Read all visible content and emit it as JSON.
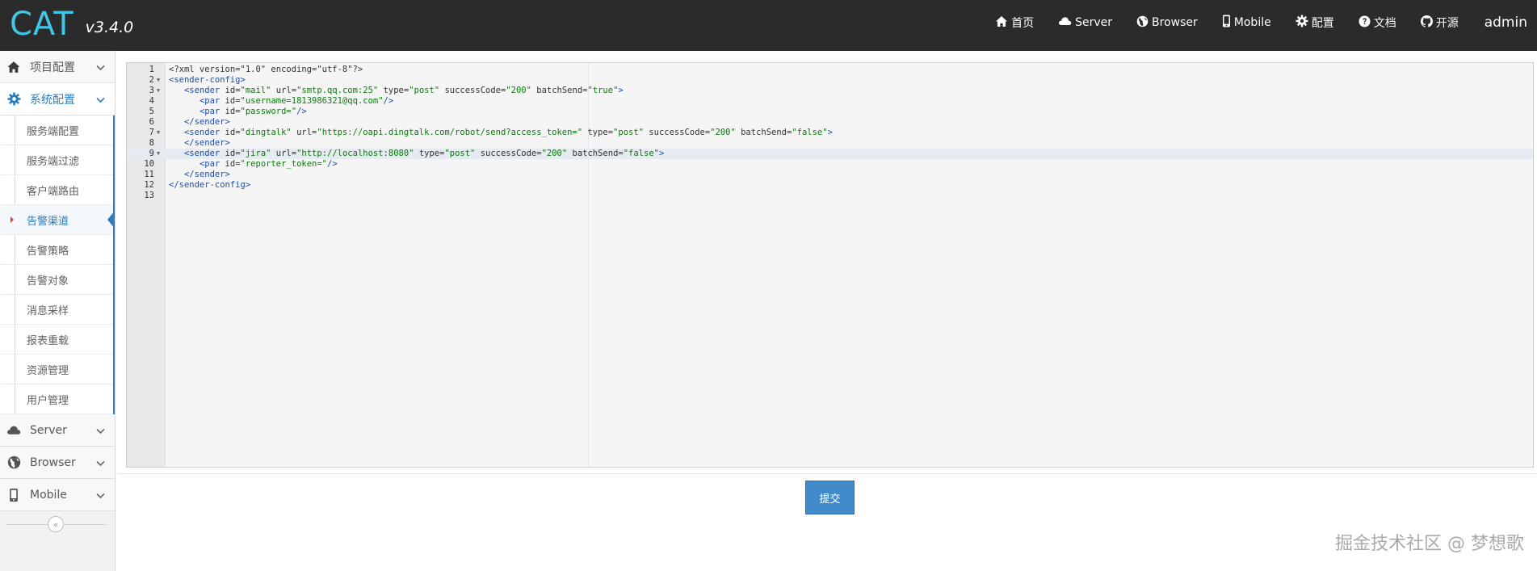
{
  "brand": {
    "logo": "CAT",
    "version": "v3.4.0"
  },
  "nav": [
    {
      "label": "首页",
      "icon": "home-icon"
    },
    {
      "label": "Server",
      "icon": "cloud-icon"
    },
    {
      "label": "Browser",
      "icon": "globe-icon"
    },
    {
      "label": "Mobile",
      "icon": "mobile-icon"
    },
    {
      "label": "配置",
      "icon": "gear-icon"
    },
    {
      "label": "文档",
      "icon": "question-icon"
    },
    {
      "label": "开源",
      "icon": "github-icon"
    }
  ],
  "user": "admin",
  "sidebar": {
    "project_config": "项目配置",
    "system_config": "系统配置",
    "sub_items": [
      "服务端配置",
      "服务端过滤",
      "客户端路由",
      "告警渠道",
      "告警策略",
      "告警对象",
      "消息采样",
      "报表重载",
      "资源管理",
      "用户管理"
    ],
    "active_sub": "告警渠道",
    "server": "Server",
    "browser": "Browser",
    "mobile": "Mobile",
    "collapse_symbol": "«"
  },
  "editor": {
    "lines": [
      "<?xml version=\"1.0\" encoding=\"utf-8\"?>",
      "<sender-config>",
      "   <sender id=\"mail\" url=\"smtp.qq.com:25\" type=\"post\" successCode=\"200\" batchSend=\"true\">",
      "      <par id=\"username=1813986321@qq.com\"/>",
      "      <par id=\"password=\"/>",
      "   </sender>",
      "   <sender id=\"dingtalk\" url=\"https://oapi.dingtalk.com/robot/send?access_token=\" type=\"post\" successCode=\"200\" batchSend=\"false\">",
      "   </sender>",
      "   <sender id=\"jira\" url=\"http://localhost:8080\" type=\"post\" successCode=\"200\" batchSend=\"false\">",
      "      <par id=\"reporter_token=\"/>",
      "   </sender>",
      "</sender-config>",
      ""
    ],
    "fold_lines": [
      2,
      3,
      7,
      9
    ],
    "highlight_line": 9
  },
  "submit_label": "提交",
  "watermark": "掘金技术社区 @ 梦想歌",
  "colors": {
    "navbar": "#2b2b2b",
    "accent": "#428bca",
    "logo": "#3fc7e8"
  }
}
